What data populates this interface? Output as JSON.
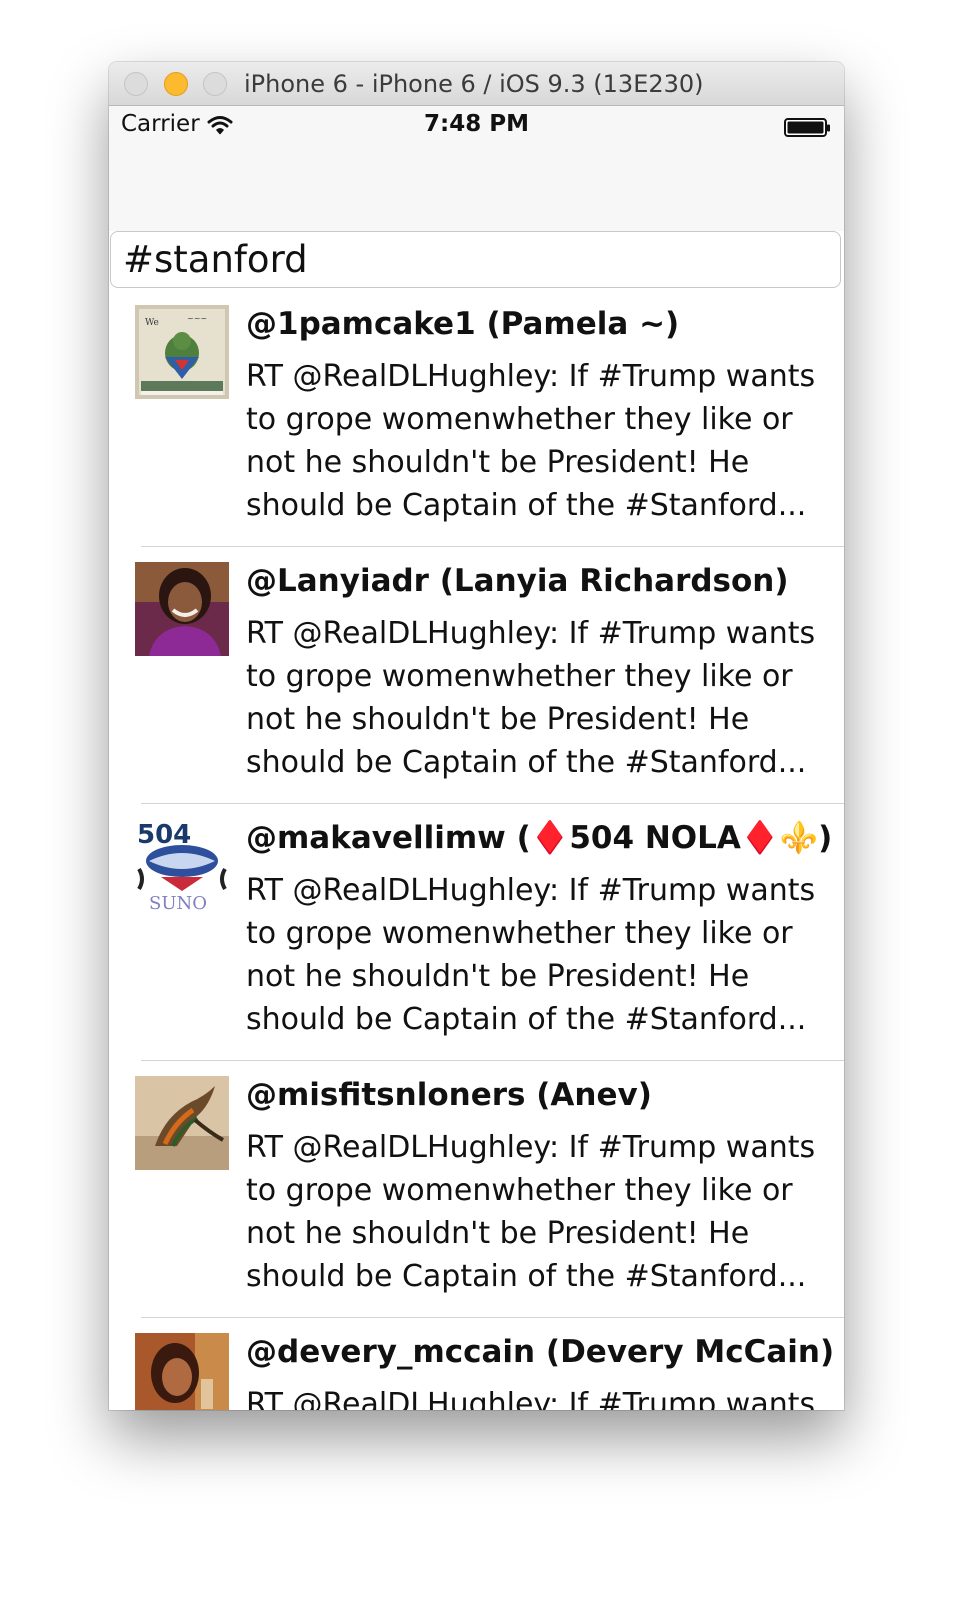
{
  "window": {
    "title": "iPhone 6 - iPhone 6 / iOS 9.3 (13E230)"
  },
  "status_bar": {
    "carrier": "Carrier",
    "time": "7:48 PM"
  },
  "search": {
    "value": "#stanford"
  },
  "tweets": [
    {
      "user": "@1pamcake1 (Pamela ~)",
      "text": "RT @RealDLHughley: If #Trump wants to grope womenwhether they like or not he shouldn't be President! He should be Captain of the #Stanford..."
    },
    {
      "user": "@Lanyiadr (Lanyia Richardson)",
      "text": "RT @RealDLHughley: If #Trump wants to grope womenwhether they like or not he shouldn't be President! He should be Captain of the #Stanford..."
    },
    {
      "user": "@makavellimw (♦️504 NOLA♦️⚜️)",
      "text": "RT @RealDLHughley: If #Trump wants to grope womenwhether they like or not he shouldn't be President! He should be Captain of the #Stanford..."
    },
    {
      "user": "@misfitsnloners (Anev)",
      "text": "RT @RealDLHughley: If #Trump wants to grope womenwhether they like or not he shouldn't be President! He should be Captain of the #Stanford..."
    },
    {
      "user": "@devery_mccain (Devery McCain)",
      "text": "RT @RealDLHughley: If #Trump wants to grope womenwhether they like or not he shouldn't be President! He should be Captain of the #Stanford..."
    }
  ],
  "colors": {
    "window_chrome": "#d8d8d8",
    "minimize_light": "#fcbb2e",
    "separator": "#d4d4d8",
    "text": "#111111"
  },
  "icons": [
    "close-light-icon",
    "minimize-light-icon",
    "zoom-light-icon",
    "wifi-icon",
    "battery-icon"
  ]
}
